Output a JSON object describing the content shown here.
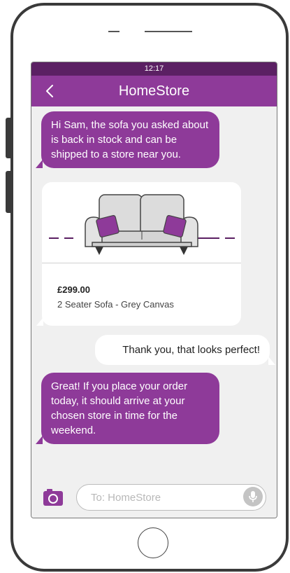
{
  "status_bar": {
    "time": "12:17"
  },
  "header": {
    "title": "HomeStore",
    "back_icon": "chevron-left-icon"
  },
  "messages": [
    {
      "direction": "incoming",
      "text": "Hi Sam, the sofa you asked about is back in stock and can be shipped to a store near you."
    },
    {
      "direction": "incoming",
      "type": "product",
      "price": "£299.00",
      "name": "2 Seater Sofa - Grey Canvas"
    },
    {
      "direction": "outgoing",
      "text": "Thank you, that looks perfect!"
    },
    {
      "direction": "incoming",
      "text": "Great! If you place your order today, it should arrive at your chosen store in time for the weekend."
    }
  ],
  "composer": {
    "placeholder": "To: HomeStore",
    "camera_icon": "camera-icon",
    "mic_icon": "microphone-icon"
  },
  "colors": {
    "brand": "#8e3a99",
    "status_bar": "#5b2063",
    "chat_background": "#f0f0f0",
    "outgoing_bubble": "#ffffff"
  }
}
